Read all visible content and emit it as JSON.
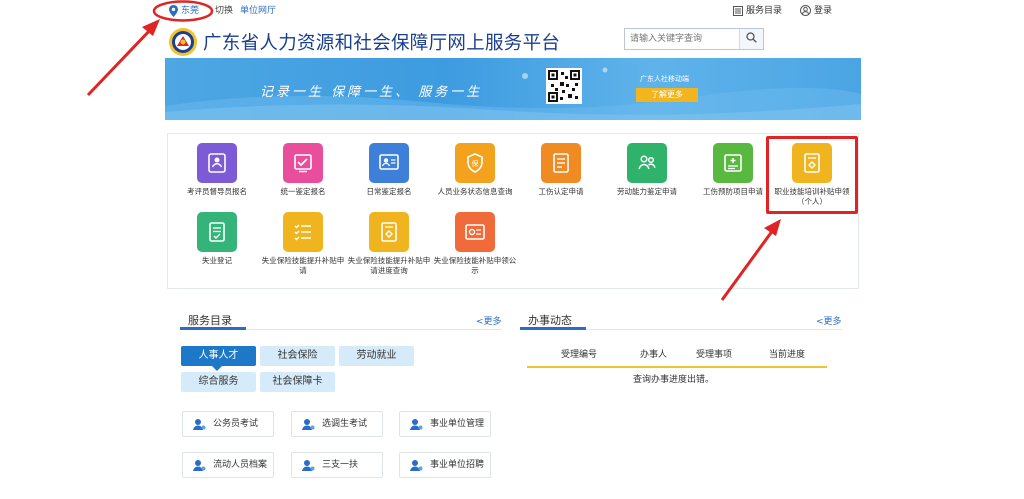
{
  "topbar": {
    "city": "东莞",
    "switch": "切换",
    "org_hall": "单位网厅",
    "service_directory": "服务目录",
    "login": "登录"
  },
  "header": {
    "title": "广东省人力资源和社会保障厅网上服务平台",
    "search_placeholder": "请输入关键字查询"
  },
  "banner": {
    "slogan": "记录一生  保障一生、  服务一生",
    "app_name": "广东人社移动端",
    "more": "了解更多"
  },
  "services": [
    {
      "label": "考评员督导员报名",
      "color": "#7d5bd6"
    },
    {
      "label": "统一鉴定报名",
      "color": "#e84e9c"
    },
    {
      "label": "日常鉴定报名",
      "color": "#3d7fd9"
    },
    {
      "label": "人员业务状态信息查询",
      "color": "#f2a21d"
    },
    {
      "label": "工伤认定申请",
      "color": "#f08a23"
    },
    {
      "label": "劳动能力鉴定申请",
      "color": "#2fb36a"
    },
    {
      "label": "工伤预防项目申请",
      "color": "#58b83f"
    },
    {
      "label": "职业技能培训补贴申领（个人）",
      "color": "#f0b51e"
    },
    {
      "label": "失业登记",
      "color": "#35b47a"
    },
    {
      "label": "失业保险技能提升补贴申请",
      "color": "#f0b51e"
    },
    {
      "label": "失业保险技能提升补贴申请进度查询",
      "color": "#f0b51e"
    },
    {
      "label": "失业保险技能补贴申领公示",
      "color": "#f06a3a"
    }
  ],
  "service_directory": {
    "title": "服务目录",
    "more": "<更多",
    "categories": [
      "人事人才",
      "社会保险",
      "劳动就业",
      "综合服务",
      "社会保障卡"
    ],
    "items": [
      "公务员考试",
      "选调生考试",
      "事业单位管理",
      "流动人员档案",
      "三支一扶",
      "事业单位招聘"
    ]
  },
  "progress": {
    "title": "办事动态",
    "more": "<更多",
    "headers": [
      "受理编号",
      "办事人",
      "受理事项",
      "当前进度"
    ],
    "message": "查询办事进度出错。"
  },
  "colors": {
    "accent": "#1e78c8",
    "highlight": "#e02323"
  }
}
